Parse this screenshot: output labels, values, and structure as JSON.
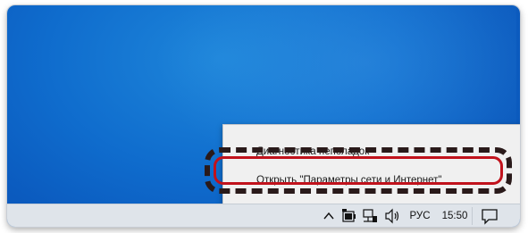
{
  "context_menu": {
    "items": [
      {
        "label": "Диагностика неполадок"
      },
      {
        "label": "Открыть \"Параметры сети и Интернет\""
      }
    ]
  },
  "taskbar": {
    "tray": {
      "overflow_icon": "chevron-up-icon",
      "battery_icon": "battery-icon",
      "network_icon": "network-icon",
      "volume_icon": "volume-icon",
      "language": "РУС",
      "time": "15:50",
      "notifications_icon": "action-center-icon"
    }
  },
  "colors": {
    "desktop": "#0f6ccd",
    "menu_bg": "#f0f0f0",
    "taskbar_bg": "#dfe4ea",
    "highlight_outline": "#c1121c",
    "highlight_dash": "#2a1a1a"
  }
}
